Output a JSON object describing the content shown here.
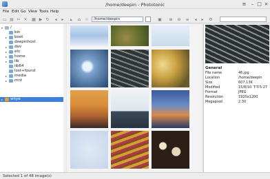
{
  "window": {
    "title": "/home/deepin - Phototonic"
  },
  "menu": [
    {
      "label": "File"
    },
    {
      "label": "Edit"
    },
    {
      "label": "Go"
    },
    {
      "label": "View"
    },
    {
      "label": "Tools"
    },
    {
      "label": "Help"
    }
  ],
  "toolbar": {
    "path_value": "/home/deepin"
  },
  "tree": {
    "root": {
      "label": "/"
    },
    "items": [
      {
        "label": "bin",
        "expandable": false
      },
      {
        "label": "boot",
        "expandable": true
      },
      {
        "label": "deepinhost",
        "expandable": false
      },
      {
        "label": "dev",
        "expandable": true
      },
      {
        "label": "etc",
        "expandable": true
      },
      {
        "label": "home",
        "expandable": true
      },
      {
        "label": "lib",
        "expandable": true
      },
      {
        "label": "lib64",
        "expandable": false
      },
      {
        "label": "lost+found",
        "expandable": false
      },
      {
        "label": "media",
        "expandable": true
      },
      {
        "label": "mnt",
        "expandable": true
      }
    ],
    "bookmark": {
      "label": "whye"
    }
  },
  "info": {
    "header": "General",
    "rows": [
      {
        "key": "File name",
        "value": "46.jpg"
      },
      {
        "key": "Location",
        "value": "/home/deepin"
      },
      {
        "key": "Size",
        "value": "607.13K"
      },
      {
        "key": "Modified",
        "value": "15/8/10 下午5:27"
      },
      {
        "key": "Format",
        "value": "JPEG"
      },
      {
        "key": "Resolution",
        "value": "1920x1200"
      },
      {
        "key": "Megapixel",
        "value": "2.30"
      }
    ]
  },
  "status": {
    "text": "Selected 1 of 48 image(s)"
  },
  "thumbnails": [
    {
      "subject": "clouds-sky"
    },
    {
      "subject": "moss-rocks"
    },
    {
      "subject": "pale-sky"
    },
    {
      "subject": "cherry-blossom"
    },
    {
      "subject": "bench-slats"
    },
    {
      "subject": "leaf-bokeh"
    },
    {
      "subject": "sunset-clouds"
    },
    {
      "subject": "pier-ocean"
    },
    {
      "subject": "city-lights"
    },
    {
      "subject": "swirl-sculpture"
    },
    {
      "subject": "tulip-field"
    },
    {
      "subject": "lanterns"
    }
  ],
  "colors": {
    "selection": "#3d7fd9",
    "folder": "#7aa6d8"
  }
}
